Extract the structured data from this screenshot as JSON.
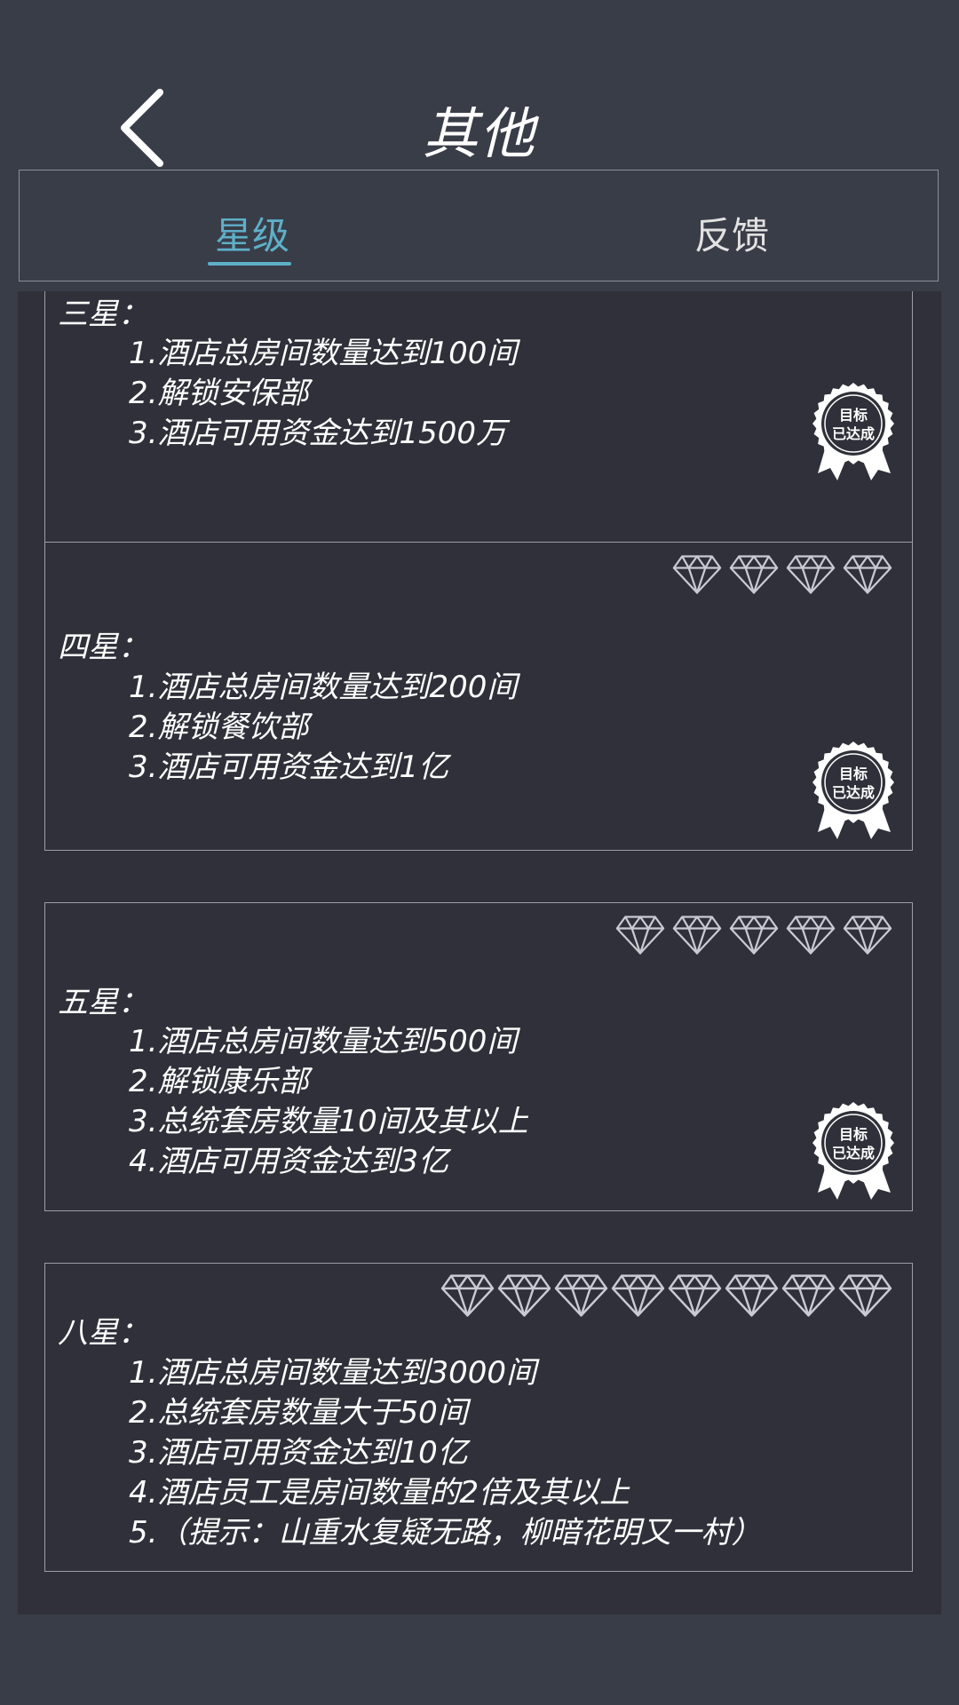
{
  "header": {
    "title": "其他"
  },
  "tabs": [
    {
      "label": "星级",
      "active": true
    },
    {
      "label": "反馈",
      "active": false
    }
  ],
  "colors": {
    "accent": "#5eb0c8",
    "background": "#393d48",
    "card": "#2f3039"
  },
  "badge": {
    "line1": "目标",
    "line2": "已达成"
  },
  "cards": [
    {
      "title": "三星：",
      "requirements": [
        "1.酒店总房间数量达到100间",
        "2.解锁安保部",
        "3.酒店可用资金达到1500万"
      ],
      "stars": 3,
      "completed": true
    },
    {
      "title": "四星：",
      "requirements": [
        "1.酒店总房间数量达到200间",
        "2.解锁餐饮部",
        "3.酒店可用资金达到1亿"
      ],
      "stars": 4,
      "completed": true
    },
    {
      "title": "五星：",
      "requirements": [
        "1.酒店总房间数量达到500间",
        "2.解锁康乐部",
        "3.总统套房数量10间及其以上",
        "4.酒店可用资金达到3亿"
      ],
      "stars": 5,
      "completed": true
    },
    {
      "title": "八星：",
      "requirements": [
        "1.酒店总房间数量达到3000间",
        "2.总统套房数量大于50间",
        "3.酒店可用资金达到10亿",
        "4.酒店员工是房间数量的2倍及其以上",
        "5.（提示：山重水复疑无路，柳暗花明又一村）"
      ],
      "stars": 8,
      "completed": false
    }
  ]
}
